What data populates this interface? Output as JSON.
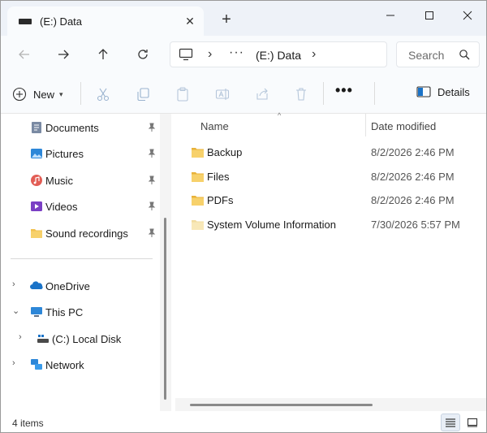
{
  "window": {
    "tab_title": "(E:) Data",
    "tab_close": "✕",
    "new_tab": "+",
    "controls": {
      "minimize": "—",
      "maximize": "☐",
      "close": "✕"
    }
  },
  "address_bar": {
    "ellipsis": "···",
    "location": "(E:) Data",
    "search_placeholder": "Search"
  },
  "command_bar": {
    "new_label": "New",
    "more": "•••",
    "details_label": "Details"
  },
  "nav_pane": {
    "quick_access": [
      {
        "label": "Documents",
        "icon": "documents-icon",
        "pinned": true
      },
      {
        "label": "Pictures",
        "icon": "pictures-icon",
        "pinned": true
      },
      {
        "label": "Music",
        "icon": "music-icon",
        "pinned": true
      },
      {
        "label": "Videos",
        "icon": "videos-icon",
        "pinned": true
      },
      {
        "label": "Sound recordings",
        "icon": "folder-icon",
        "pinned": true
      }
    ],
    "tree": [
      {
        "label": "OneDrive",
        "icon": "onedrive-icon",
        "expanded": false
      },
      {
        "label": "This PC",
        "icon": "this-pc-icon",
        "expanded": true
      },
      {
        "label": "(C:) Local Disk",
        "icon": "drive-icon",
        "expanded": false
      },
      {
        "label": "Network",
        "icon": "network-icon",
        "expanded": false
      }
    ]
  },
  "file_list": {
    "columns": {
      "name": "Name",
      "date_modified": "Date modified"
    },
    "rows": [
      {
        "name": "Backup",
        "date_modified": "8/2/2026 2:46 PM",
        "hidden": false
      },
      {
        "name": "Files",
        "date_modified": "8/2/2026 2:46 PM",
        "hidden": false
      },
      {
        "name": "PDFs",
        "date_modified": "8/2/2026 2:46 PM",
        "hidden": false
      },
      {
        "name": "System Volume Information",
        "date_modified": "7/30/2026 5:57 PM",
        "hidden": true
      }
    ]
  },
  "status_bar": {
    "item_count": "4 items"
  },
  "colors": {
    "titlebar_bg": "#eef2f8",
    "toolbar_bg": "#f9fbfd",
    "folder_yellow": "#f2c14e",
    "accent_blue": "#1a73c8"
  }
}
